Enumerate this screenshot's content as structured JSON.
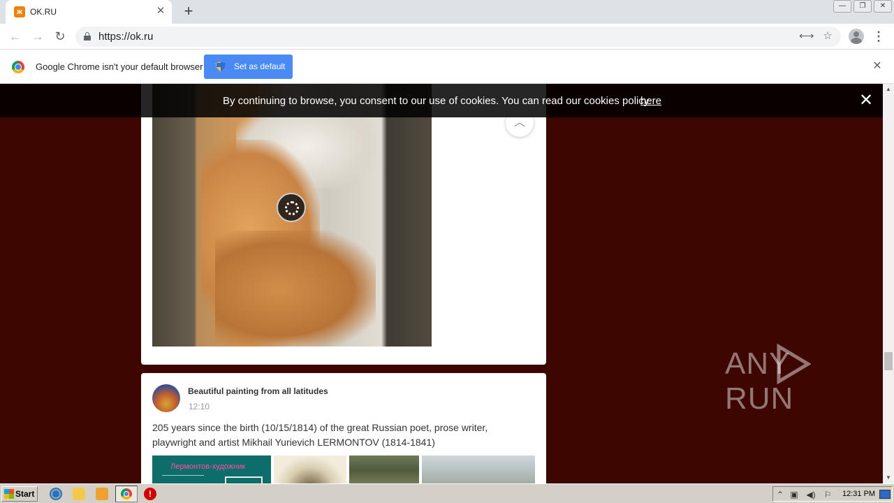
{
  "tab": {
    "favicon": "ok",
    "title": "OK.RU",
    "close": "✕"
  },
  "new_tab": "+",
  "window": {
    "minimize": "—",
    "restore": "❐",
    "close": "✕"
  },
  "toolbar": {
    "back": "←",
    "forward": "→",
    "reload": "↻",
    "url": "https://ok.ru",
    "translate": "⟷",
    "bookmark": "☆",
    "menu": "⋮"
  },
  "infobar": {
    "message": "Google Chrome isn't your default browser",
    "button": "Set as default",
    "close": "✕"
  },
  "cookie": {
    "text": "By continuing to browse, you consent to our use of cookies. You can read our cookies policy",
    "link": "here",
    "close": "✕"
  },
  "feed": {
    "scroll_top": "︿",
    "post": {
      "group_name": "Beautiful painting from all latitudes",
      "time": "12:10",
      "text": "205 years since the birth (10/15/1814) of the great Russian poet, prose writer, playwright and artist Mikhail Yurievich LERMONTOV (1814-1841)",
      "thumb_title": "Лермонтов-художник"
    }
  },
  "watermark": {
    "left": "ANY",
    "right": "RUN"
  },
  "scrollbar": {
    "up": "▲",
    "down": "▼"
  },
  "taskbar": {
    "start": "Start",
    "time": "12:31 PM",
    "stop": "!"
  },
  "colors": {
    "page_bg": "#3d0600",
    "accent": "#4a8af4",
    "ok_orange": "#ee8208"
  }
}
